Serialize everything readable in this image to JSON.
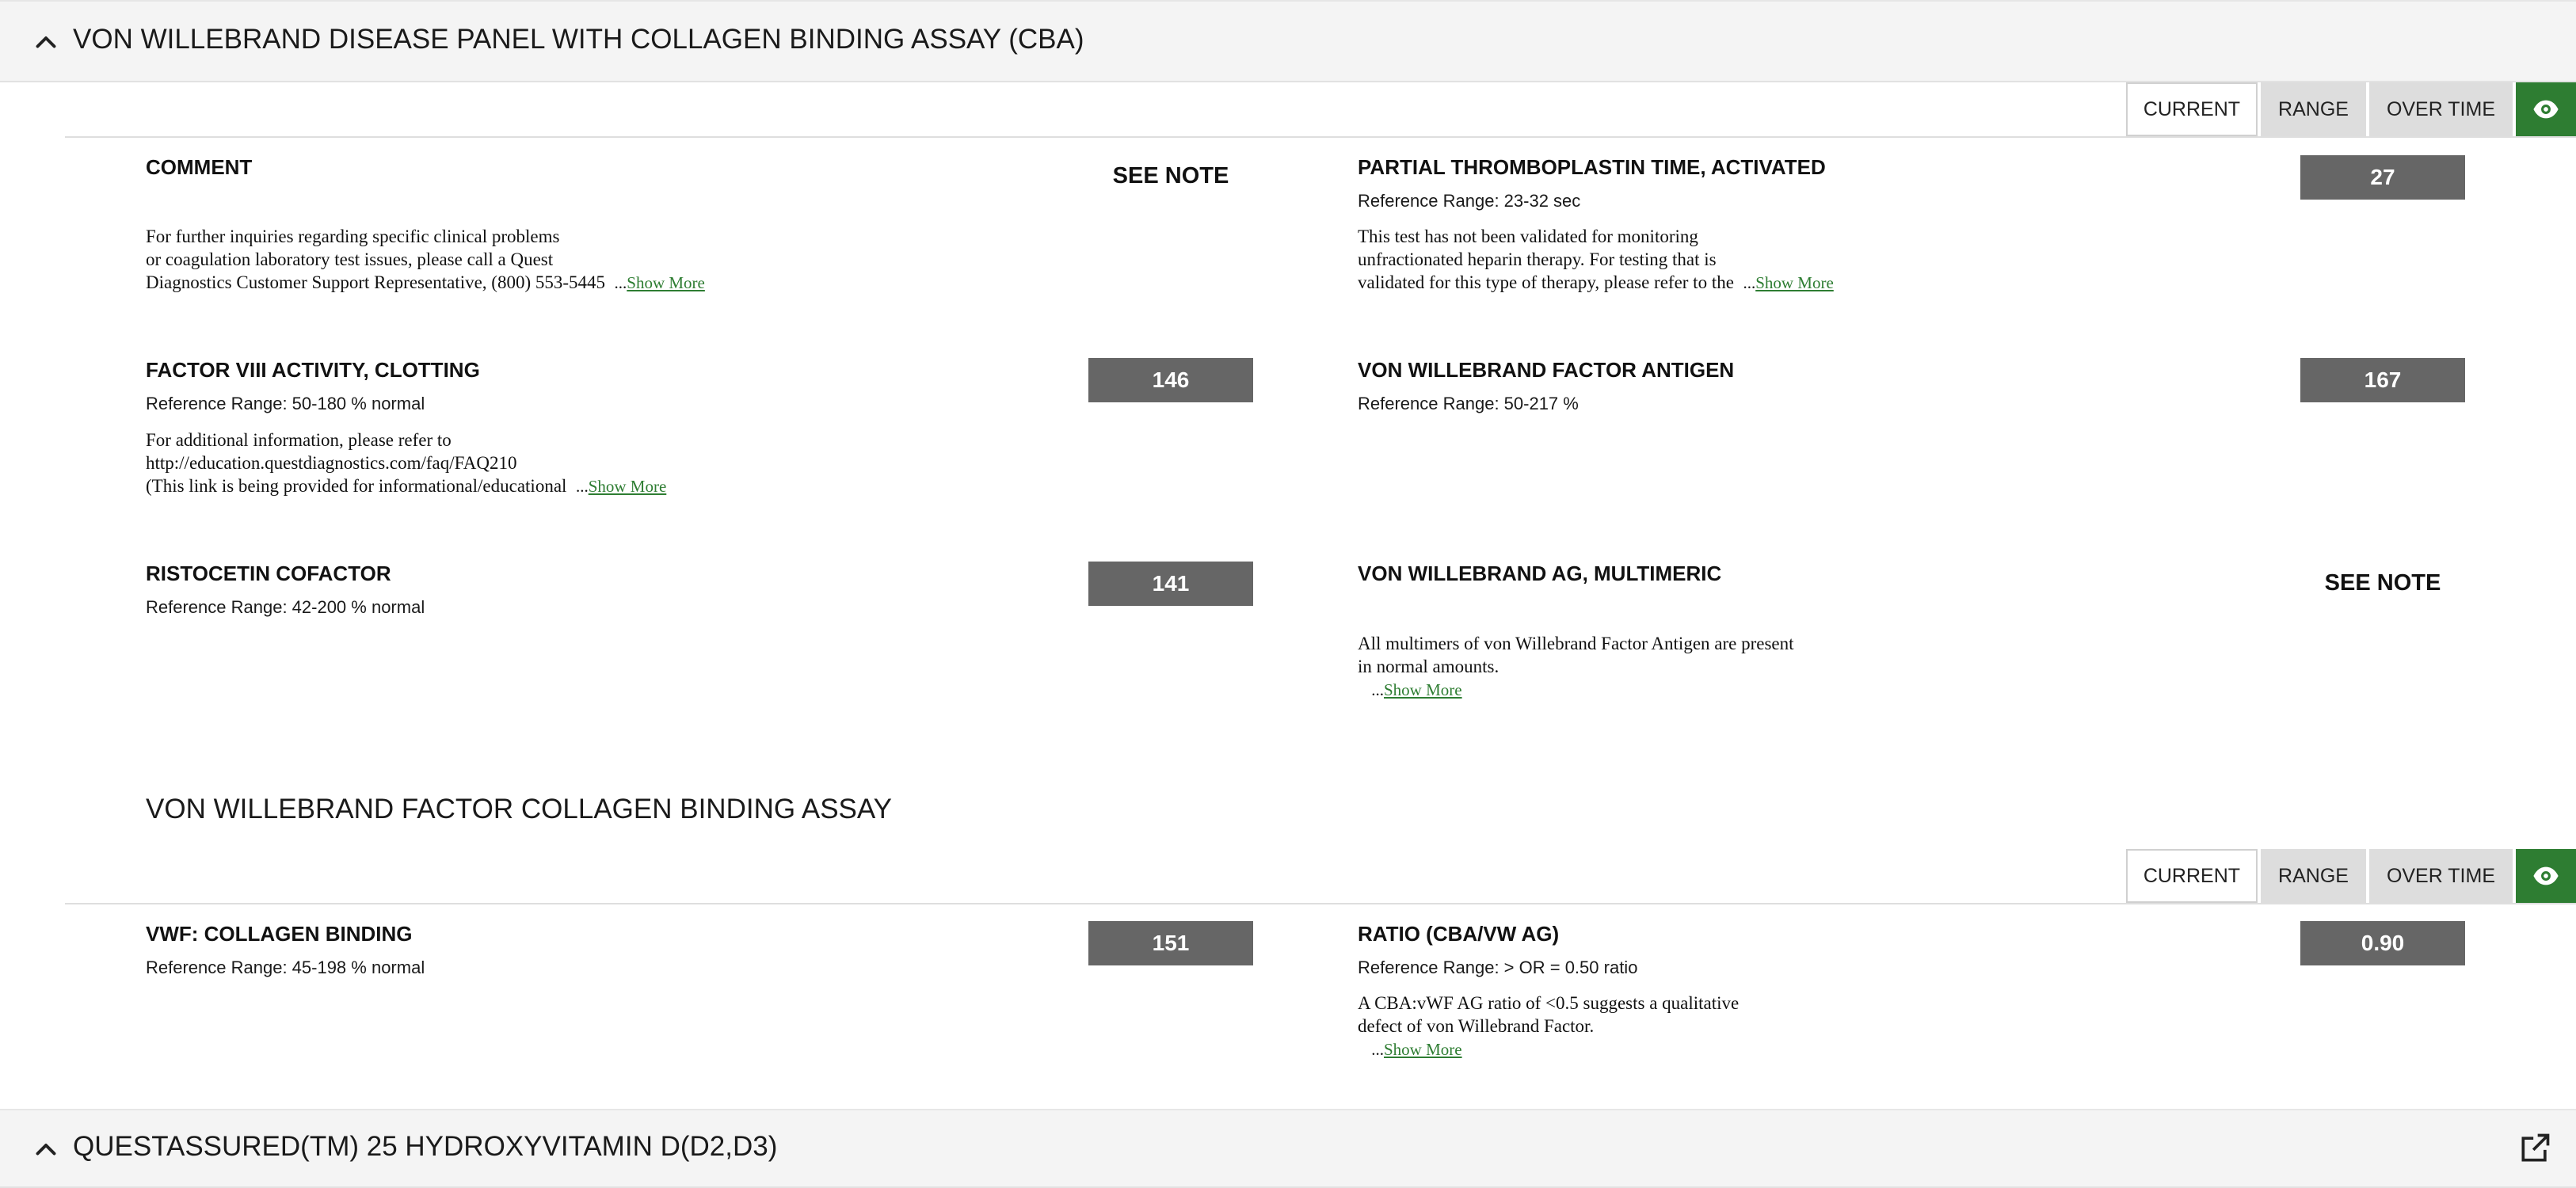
{
  "panel1": {
    "title": "VON WILLEBRAND DISEASE PANEL WITH COLLAGEN BINDING ASSAY (CBA)",
    "collapse_icon": "chevron-up-icon"
  },
  "toolbar": {
    "current_label": "CURRENT",
    "range_label": "RANGE",
    "over_time_label": "OVER TIME",
    "eye_icon": "eye-icon",
    "eye_color": "#2e7d32"
  },
  "tests": {
    "comment": {
      "name": "COMMENT",
      "value": "SEE NOTE",
      "note_lines": [
        "For further inquiries regarding specific clinical problems",
        "or coagulation laboratory test issues, please call a Quest",
        "Diagnostics Customer Support Representative, (800) 553-5445"
      ]
    },
    "ptt": {
      "name": "PARTIAL THROMBOPLASTIN TIME, ACTIVATED",
      "reference": "Reference Range: 23-32 sec",
      "value": "27",
      "note_lines": [
        "This test has not been validated for monitoring",
        "unfractionated heparin therapy. For testing that is",
        "validated for this type of therapy, please refer to the"
      ]
    },
    "factor8": {
      "name": "FACTOR VIII ACTIVITY, CLOTTING",
      "reference": "Reference Range: 50-180 % normal",
      "value": "146",
      "note_lines": [
        "For additional information, please refer to",
        "http://education.questdiagnostics.com/faq/FAQ210",
        "(This link is being provided for informational/educational"
      ]
    },
    "vwf_antigen": {
      "name": "VON WILLEBRAND FACTOR ANTIGEN",
      "reference": "Reference Range: 50-217 %",
      "value": "167"
    },
    "ristocetin": {
      "name": "RISTOCETIN COFACTOR",
      "reference": "Reference Range: 42-200 % normal",
      "value": "141"
    },
    "multimeric": {
      "name": "VON WILLEBRAND AG, MULTIMERIC",
      "value": "SEE NOTE",
      "note_lines": [
        "All multimers of von Willebrand Factor Antigen are present",
        "in normal amounts."
      ]
    },
    "collagen_binding": {
      "name": "VWF: COLLAGEN BINDING",
      "reference": "Reference Range: 45-198 % normal",
      "value": "151"
    },
    "ratio": {
      "name": "RATIO (CBA/VW AG)",
      "reference": "Reference Range: > OR = 0.50 ratio",
      "value": "0.90",
      "note_lines": [
        "A CBA:vWF AG ratio of <0.5 suggests a qualitative",
        "defect of von Willebrand Factor."
      ]
    }
  },
  "subsection": {
    "title": "VON WILLEBRAND FACTOR COLLAGEN BINDING ASSAY"
  },
  "show_more": {
    "ellipsis": "...",
    "label": "Show More",
    "color": "#2e7d32"
  },
  "panel2": {
    "title": "QUESTASSURED(TM) 25 HYDROXYVITAMIN D(D2,D3)",
    "collapse_icon": "chevron-up-icon",
    "external_icon": "external-link-icon"
  },
  "colors": {
    "value_box_bg": "#666666",
    "header_bg": "#f4f4f4",
    "accent": "#2e7d32"
  }
}
